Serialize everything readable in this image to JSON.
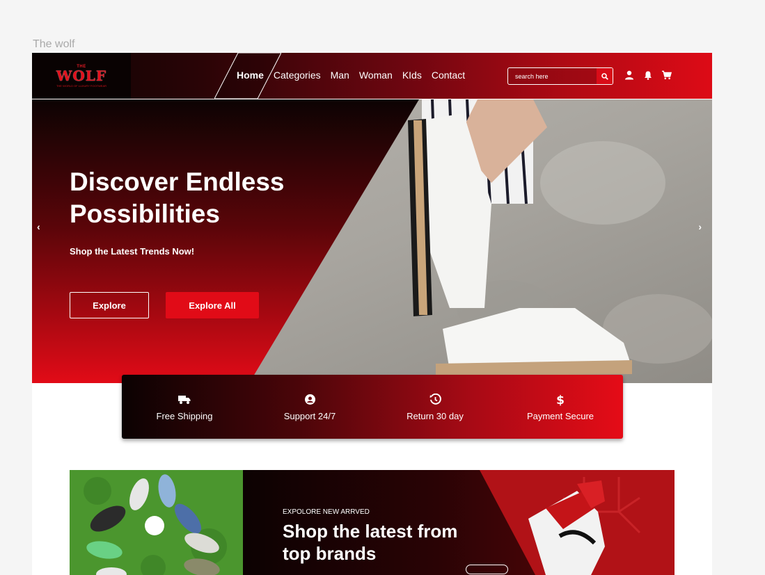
{
  "frame": {
    "title": "The wolf"
  },
  "brand": {
    "top": "THE",
    "name": "WOLF",
    "tagline": "THE WORLD OF LUXURY FOOTWEAR"
  },
  "nav": {
    "links": [
      "Home",
      "Categories",
      "Man",
      "Woman",
      "KIds",
      "Contact"
    ],
    "active": "Home"
  },
  "search": {
    "placeholder": "search here",
    "icon": "search-icon"
  },
  "icons": [
    "user-icon",
    "bell-icon",
    "cart-icon"
  ],
  "hero": {
    "title": "Discover Endless Possibilities",
    "subtitle": "Shop the Latest Trends Now!",
    "primary_button": "Explore",
    "secondary_button": "Explore All",
    "prev_arrow": "‹",
    "next_arrow": "›"
  },
  "features": [
    {
      "label": "Free Shipping",
      "icon": "truck-icon"
    },
    {
      "label": "Support 24/7",
      "icon": "support-icon"
    },
    {
      "label": "Return 30 day",
      "icon": "history-icon"
    },
    {
      "label": "Payment Secure",
      "icon": "dollar-icon"
    }
  ],
  "promo": {
    "eyebrow": "EXPOLORE NEW ARRVED",
    "title": "Shop the latest from top brands"
  },
  "colors": {
    "accent": "#e10b17",
    "dark": "#0b0202",
    "frame_bg": "#f5f5f5"
  }
}
